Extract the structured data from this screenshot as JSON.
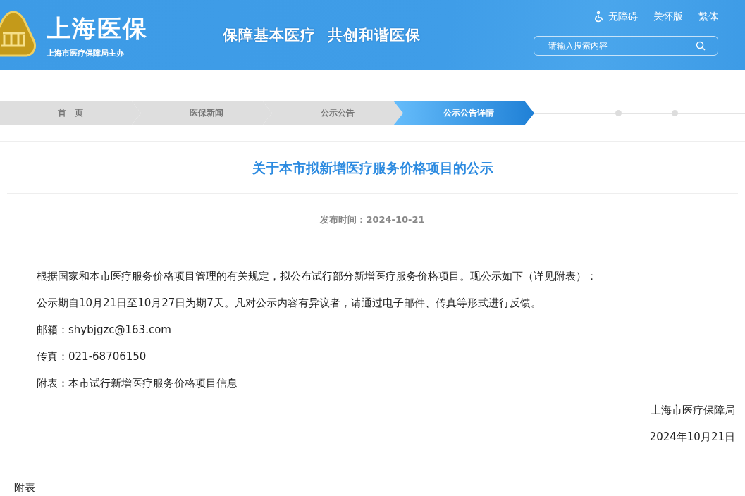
{
  "header": {
    "site_title": "上海医保",
    "site_subtitle": "上海市医疗保障局主办",
    "slogan": "保障基本医疗  共创和谐医保",
    "links": [
      {
        "label": "无障碍",
        "kind": "accessibility"
      },
      {
        "label": "关怀版",
        "kind": "plain"
      },
      {
        "label": "繁体",
        "kind": "plain"
      }
    ],
    "search": {
      "placeholder": "请输入搜索内容"
    }
  },
  "breadcrumb": [
    {
      "label": "首　页",
      "selected": false
    },
    {
      "label": "医保新闻",
      "selected": false
    },
    {
      "label": "公示公告",
      "selected": false
    },
    {
      "label": "公示公告详情",
      "selected": true
    }
  ],
  "article": {
    "title": "关于本市拟新增医疗服务价格项目的公示",
    "publish_time": "发布时间：2024-10-21",
    "paragraphs": [
      "根据国家和本市医疗服务价格项目管理的有关规定，拟公布试行部分新增医疗服务价格项目。现公示如下（详见附表）：",
      "公示期自10月21日至10月27日为期7天。凡对公示内容有异议者，请通过电子邮件、传真等形式进行反馈。",
      "邮箱：shybjgzc@163.com",
      "传真：021-68706150",
      "附表：本市试行新增医疗服务价格项目信息"
    ],
    "signature": [
      "上海市医疗保障局",
      "2024年10月21日"
    ],
    "attachment_heading": "附表"
  }
}
